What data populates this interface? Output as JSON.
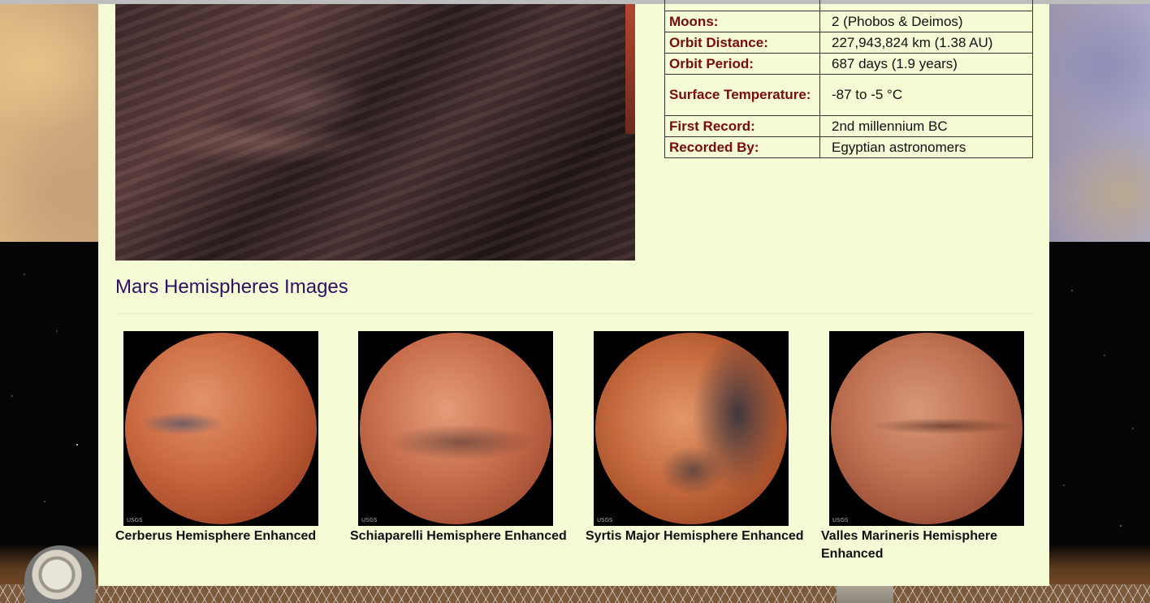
{
  "facts": {
    "rows": [
      {
        "label": "Moons:",
        "value": "2 (Phobos & Deimos)"
      },
      {
        "label": "Orbit Distance:",
        "value": "227,943,824 km (1.38 AU)"
      },
      {
        "label": "Orbit Period:",
        "value": "687 days (1.9 years)"
      },
      {
        "label": "Surface Temperature:",
        "value": "-87 to -5 °C"
      },
      {
        "label": "First Record:",
        "value": "2nd millennium BC"
      },
      {
        "label": "Recorded By:",
        "value": "Egyptian astronomers"
      }
    ]
  },
  "hemispheres": {
    "title": "Mars Hemispheres Images",
    "items": [
      {
        "caption": "Cerberus Hemisphere Enhanced"
      },
      {
        "caption": "Schiaparelli Hemisphere Enhanced"
      },
      {
        "caption": "Syrtis Major Hemisphere Enhanced"
      },
      {
        "caption": "Valles Marineris Hemisphere Enhanced"
      }
    ],
    "badge": "USGS"
  }
}
